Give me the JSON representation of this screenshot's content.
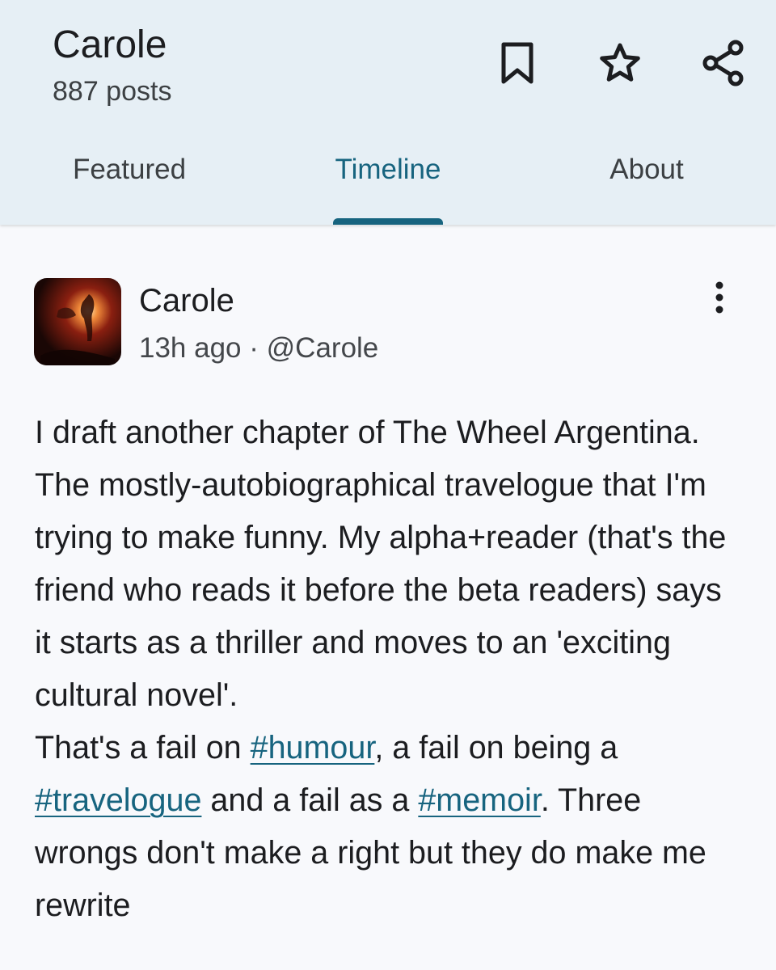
{
  "header": {
    "profile_name": "Carole",
    "post_count": "887 posts"
  },
  "header_actions": [
    {
      "icon": "bookmark-icon"
    },
    {
      "icon": "star-icon"
    },
    {
      "icon": "share-icon"
    }
  ],
  "tabs": [
    {
      "label": "Featured",
      "active": false
    },
    {
      "label": "Timeline",
      "active": true
    },
    {
      "label": "About",
      "active": false
    }
  ],
  "colors": {
    "header_bg": "#e6eff5",
    "accent": "#17647f",
    "page_bg": "#f8f9fc",
    "text": "#1c1d20"
  },
  "post": {
    "author": "Carole",
    "time": "13h ago",
    "separator": " · ",
    "handle": "@Carole",
    "paragraph1": "I draft another chapter of The Wheel Argentina. The mostly-autobiographical travelogue that I'm trying to make funny. My alpha+reader (that's the friend who reads it before the beta readers) says it starts as a thriller and moves to an 'exciting cultural novel'.",
    "p2_part1": "That's a fail on ",
    "hashtag1": "#humour",
    "p2_part2": ", a fail on being a ",
    "hashtag2": "#travelogue",
    "p2_part3": " and a fail as a ",
    "hashtag3": "#memoir",
    "p2_part4": ". Three wrongs don't make a right but they do make me rewrite"
  }
}
